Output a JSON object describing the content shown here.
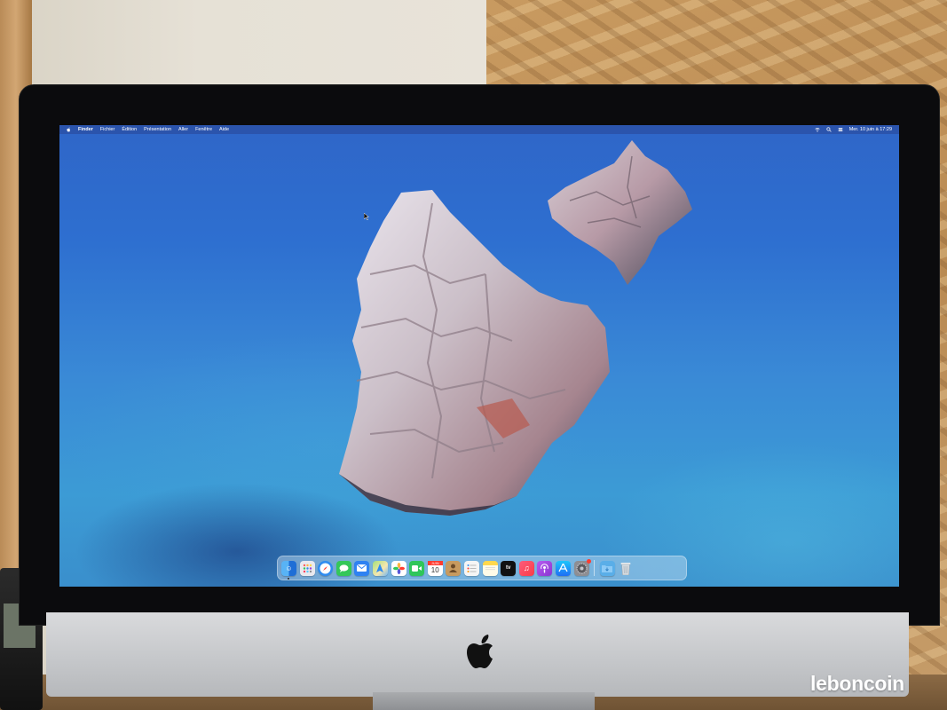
{
  "menubar": {
    "app_name": "Finder",
    "menus": [
      "Fichier",
      "Édition",
      "Présentation",
      "Aller",
      "Fenêtre",
      "Aide"
    ],
    "clock": "Mer. 10 juin à  17:29"
  },
  "dock": {
    "calendar": {
      "month": "JUIN",
      "day": "10"
    },
    "apps": [
      {
        "name": "Finder",
        "icon": "finder-icon",
        "color": "#3a8ee6"
      },
      {
        "name": "Launchpad",
        "icon": "launchpad-icon",
        "color": "#e9e9ef"
      },
      {
        "name": "Safari",
        "icon": "safari-icon",
        "color": "#2f8cf0"
      },
      {
        "name": "Messages",
        "icon": "messages-icon",
        "color": "#34c759"
      },
      {
        "name": "Mail",
        "icon": "mail-icon",
        "color": "#2e82f2"
      },
      {
        "name": "Maps",
        "icon": "maps-icon",
        "color": "#7dcf6f"
      },
      {
        "name": "Photos",
        "icon": "photos-icon",
        "color": "#ffffff"
      },
      {
        "name": "FaceTime",
        "icon": "facetime-icon",
        "color": "#2fc65a"
      },
      {
        "name": "Calendar",
        "icon": "calendar-icon",
        "color": "#ffffff"
      },
      {
        "name": "Contacts",
        "icon": "contacts-icon",
        "color": "#c79a5f"
      },
      {
        "name": "Reminders",
        "icon": "reminders-icon",
        "color": "#f5f5f5"
      },
      {
        "name": "Notes",
        "icon": "notes-icon",
        "color": "#ffd84d"
      },
      {
        "name": "TV",
        "icon": "tv-icon",
        "color": "#111111"
      },
      {
        "name": "Music",
        "icon": "music-icon",
        "color": "#fc3c5a"
      },
      {
        "name": "Podcasts",
        "icon": "podcasts-icon",
        "color": "#9b46d8"
      },
      {
        "name": "App Store",
        "icon": "app-store-icon",
        "color": "#1e8cf5"
      },
      {
        "name": "System Preferences",
        "icon": "system-preferences-icon",
        "color": "#8e8e93"
      },
      {
        "name": "Downloads",
        "icon": "downloads-folder-icon",
        "color": "#5aaee8"
      },
      {
        "name": "Trash",
        "icon": "trash-icon",
        "color": "#d5dbe0"
      }
    ]
  },
  "watermark": "leboncoin"
}
